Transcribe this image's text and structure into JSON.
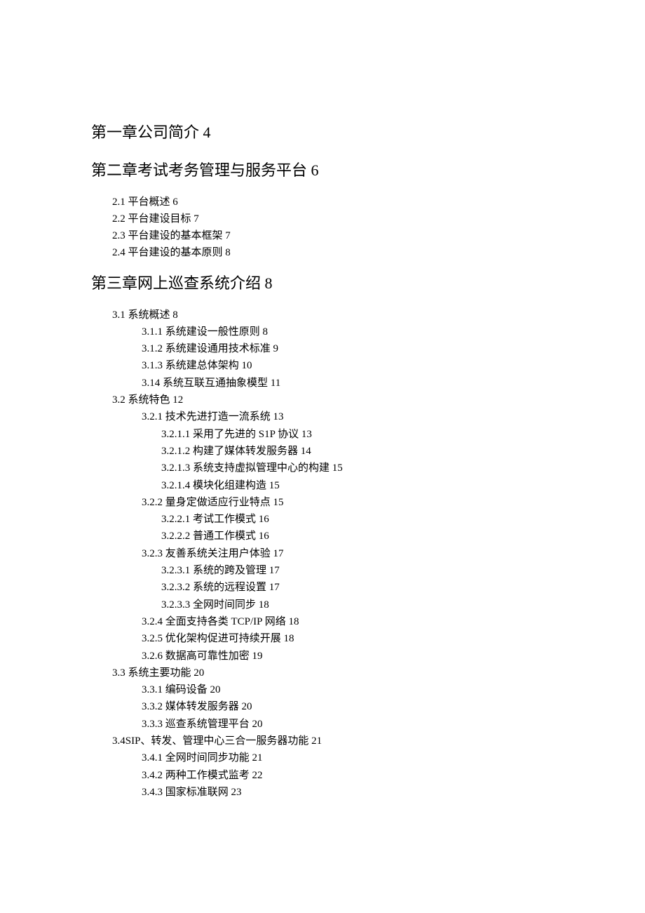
{
  "chapters": [
    {
      "heading": "第一章公司简介 4",
      "items": []
    },
    {
      "heading": "第二章考试考务管理与服务平台 6",
      "items": [
        {
          "text": "2.1 平台概述 6",
          "level": 2
        },
        {
          "text": "2.2 平台建设目标 7",
          "level": 2
        },
        {
          "text": "2.3 平台建设的基本框架 7",
          "level": 2
        },
        {
          "text": "2.4 平台建设的基本原则 8",
          "level": 2
        }
      ]
    },
    {
      "heading": "第三章网上巡查系统介绍 8",
      "items": [
        {
          "text": "3.1 系统概述 8",
          "level": 2
        },
        {
          "text": "3.1.1 系统建设一般性原则 8",
          "level": 3
        },
        {
          "text": "3.1.2 系统建设通用技术标准 9",
          "level": 3
        },
        {
          "text": "3.1.3 系统建总体架构 10",
          "level": 3
        },
        {
          "text": "3.14 系统互联互通抽象模型 11",
          "level": 3
        },
        {
          "text": "3.2 系统特色 12",
          "level": 2
        },
        {
          "text": "3.2.1 技术先进打造一流系统 13",
          "level": 3
        },
        {
          "text": "3.2.1.1 采用了先进的 S1P 协议 13",
          "level": 4
        },
        {
          "text": "3.2.1.2 构建了媒体转发服务器 14",
          "level": 4
        },
        {
          "text": "3.2.1.3 系统支持虚拟管理中心的构建 15",
          "level": 4
        },
        {
          "text": "3.2.1.4 模块化组建构造 15",
          "level": 4
        },
        {
          "text": "3.2.2 量身定做适应行业特点 15",
          "level": 3
        },
        {
          "text": "3.2.2.1 考试工作模式 16",
          "level": 4
        },
        {
          "text": "3.2.2.2 普通工作模式 16",
          "level": 4
        },
        {
          "text": "3.2.3 友善系统关注用户体验 17",
          "level": 3
        },
        {
          "text": "3.2.3.1 系统的跨及管理 17",
          "level": 4
        },
        {
          "text": "3.2.3.2 系统的远程设置 17",
          "level": 4
        },
        {
          "text": "3.2.3.3 全网时间同步 18",
          "level": 4
        },
        {
          "text": "3.2.4 全面支持各类 TCP/IP 网络 18",
          "level": 3
        },
        {
          "text": "3.2.5 优化架构促进可持续开展 18",
          "level": 3
        },
        {
          "text": "3.2.6 数据高可靠性加密 19",
          "level": 3
        },
        {
          "text": "3.3 系统主要功能 20",
          "level": 2
        },
        {
          "text": "3.3.1 编码设备 20",
          "level": 3
        },
        {
          "text": "3.3.2 媒体转发服务器 20",
          "level": 3
        },
        {
          "text": "3.3.3 巡查系统管理平台 20",
          "level": 3
        },
        {
          "text": "3.4SIP、转发、管理中心三合一服务器功能 21",
          "level": 2
        },
        {
          "text": "3.4.1 全网时间同步功能 21",
          "level": 3
        },
        {
          "text": "3.4.2 两种工作模式监考 22",
          "level": 3
        },
        {
          "text": "3.4.3 国家标准联网 23",
          "level": 3
        }
      ]
    }
  ]
}
